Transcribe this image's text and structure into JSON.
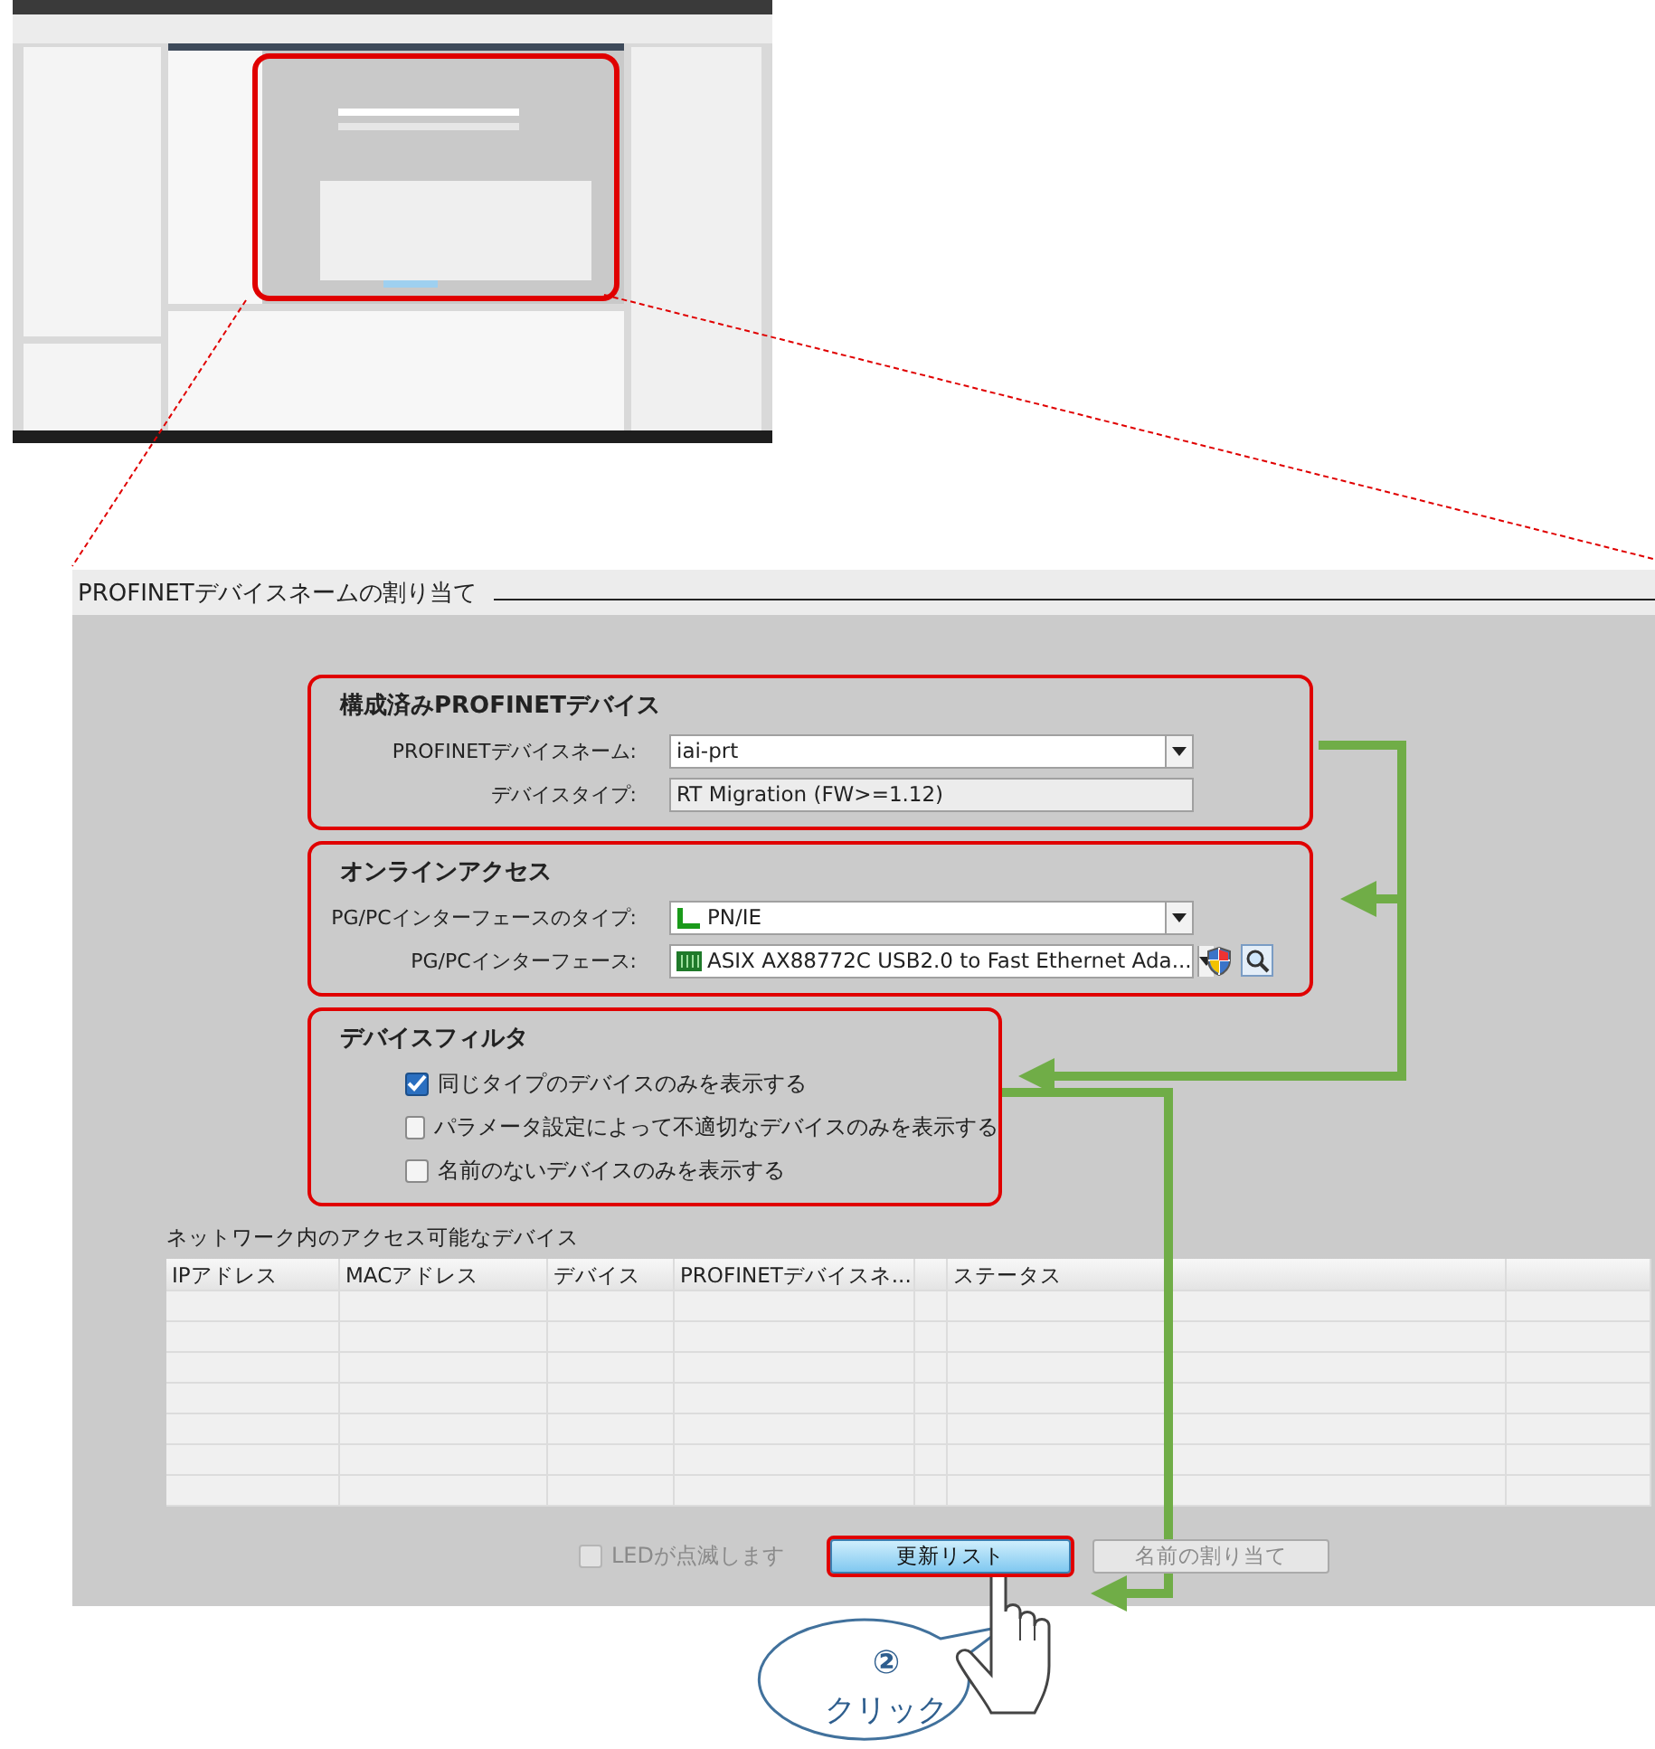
{
  "dialog": {
    "title": "PROFINETデバイスネームの割り当て",
    "groups": [
      {
        "heading": "構成済みPROFINETデバイス",
        "fields": [
          {
            "label": "PROFINETデバイスネーム:",
            "value": "iai-prt",
            "kind": "dropdown"
          },
          {
            "label": "デバイスタイプ:",
            "value": "RT Migration (FW>=1.12)",
            "kind": "readonly"
          }
        ]
      },
      {
        "heading": "オンラインアクセス",
        "fields": [
          {
            "label": "PG/PCインターフェースのタイプ:",
            "value": "PN/IE",
            "kind": "dropdown"
          },
          {
            "label": "PG/PCインターフェース:",
            "value": "ASIX AX88772C USB2.0 to Fast Ethernet Ada...",
            "kind": "dropdown"
          }
        ]
      },
      {
        "heading": "デバイスフィルタ",
        "options": [
          {
            "label": "同じタイプのデバイスのみを表示する",
            "checked": true
          },
          {
            "label": "パラメータ設定によって不適切なデバイスのみを表示する",
            "checked": false
          },
          {
            "label": "名前のないデバイスのみを表示する",
            "checked": false
          }
        ]
      }
    ],
    "table": {
      "caption": "ネットワーク内のアクセス可能なデバイス",
      "columns": [
        "IPアドレス",
        "MACアドレス",
        "デバイス",
        "PROFINETデバイスネ...",
        "",
        "ステータス",
        ""
      ]
    },
    "led_checkbox": {
      "label": "LEDが点滅します",
      "checked": false,
      "disabled": true
    },
    "buttons": [
      {
        "label": "更新リスト",
        "disabled": false,
        "highlighted": true
      },
      {
        "label": "名前の割り当て",
        "disabled": true,
        "highlighted": false
      }
    ]
  },
  "callout": {
    "number": "②",
    "text": "クリック"
  }
}
